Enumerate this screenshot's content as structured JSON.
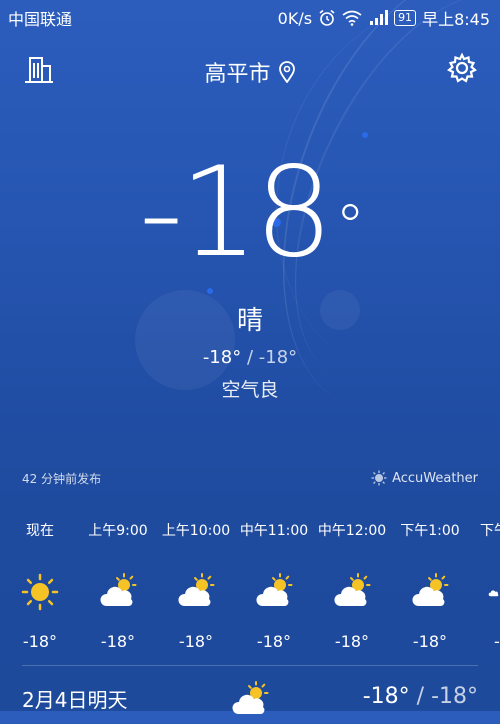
{
  "status_bar": {
    "carrier": "中国联通",
    "net_speed": "0K/s",
    "battery": "91",
    "time": "早上8:45"
  },
  "header": {
    "city": "高平市"
  },
  "current": {
    "temp": "-18",
    "deg_symbol": "°",
    "condition": "晴",
    "high": "-18°",
    "separator": "/",
    "low": "-18°",
    "air_quality": "空气良"
  },
  "meta": {
    "updated": "42 分钟前发布",
    "source": "AccuWeather"
  },
  "hourly": [
    {
      "time": "现在",
      "icon": "sun-icon",
      "temp": "-18°"
    },
    {
      "time": "上午9:00",
      "icon": "sun-cloud-icon",
      "temp": "-18°"
    },
    {
      "time": "上午10:00",
      "icon": "sun-cloud-icon",
      "temp": "-18°"
    },
    {
      "time": "中午11:00",
      "icon": "sun-cloud-icon",
      "temp": "-18°"
    },
    {
      "time": "中午12:00",
      "icon": "sun-cloud-icon",
      "temp": "-18°"
    },
    {
      "time": "下午1:00",
      "icon": "sun-cloud-icon",
      "temp": "-18°"
    },
    {
      "time": "下午",
      "icon": "cloud-icon",
      "temp": "-"
    }
  ],
  "daily": [
    {
      "date": "2月4日明天",
      "icon": "sun-cloud-icon",
      "high": "-18°",
      "separator": "/",
      "low": "-18°"
    }
  ],
  "colors": {
    "sun": "#f6c327",
    "accent_dot": "#2a6ae8"
  }
}
